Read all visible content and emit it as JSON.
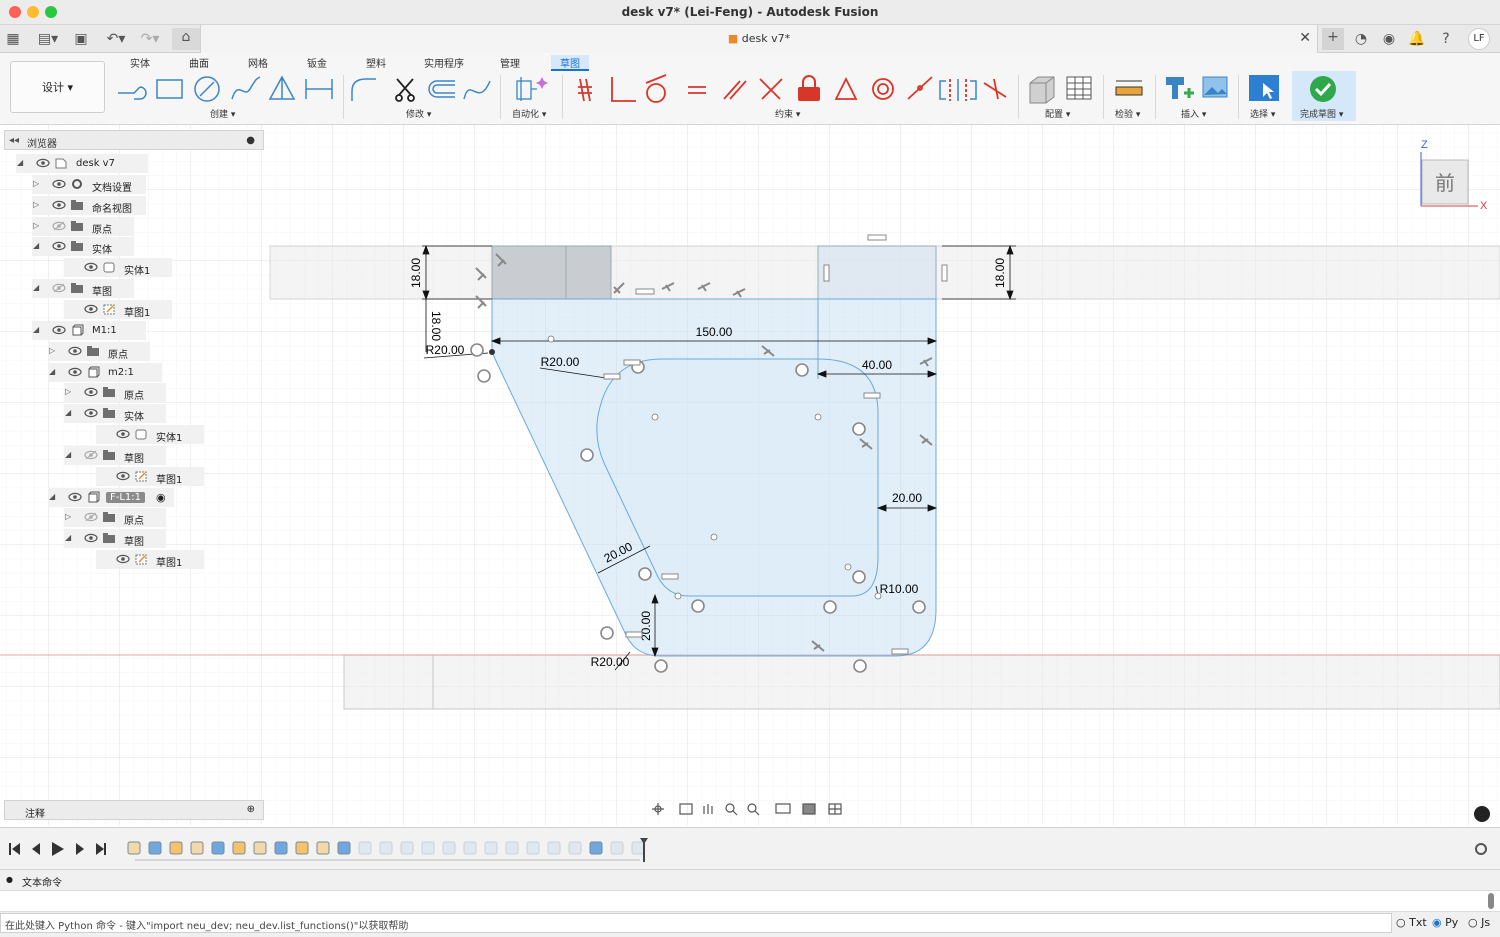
{
  "window": {
    "title": "desk v7* (Lei-Feng) - Autodesk Fusion"
  },
  "tabbar": {
    "doc_tab": "desk v7*",
    "avatar": "LF"
  },
  "ribbon": {
    "workspace": "设计 ▾",
    "tabs": [
      "实体",
      "曲面",
      "网格",
      "钣金",
      "塑料",
      "实用程序",
      "管理",
      "草图"
    ],
    "active_tab": "草图",
    "groups": {
      "create": "创建 ▾",
      "modify": "修改 ▾",
      "automate": "自动化 ▾",
      "constraints": "约束 ▾",
      "configure": "配置 ▾",
      "inspect": "检验 ▾",
      "insert": "插入 ▾",
      "select": "选择 ▾",
      "finish": "完成草图 ▾"
    }
  },
  "browser": {
    "title": "浏览器",
    "items": [
      {
        "label": "desk v7"
      },
      {
        "label": "文档设置"
      },
      {
        "label": "命名视图"
      },
      {
        "label": "原点"
      },
      {
        "label": "实体"
      },
      {
        "label": "实体1"
      },
      {
        "label": "草图"
      },
      {
        "label": "草图1"
      },
      {
        "label": "M1:1"
      },
      {
        "label": "原点"
      },
      {
        "label": "m2:1"
      },
      {
        "label": "原点"
      },
      {
        "label": "实体"
      },
      {
        "label": "实体1"
      },
      {
        "label": "草图"
      },
      {
        "label": "草图1"
      },
      {
        "label": "F-L1:1"
      },
      {
        "label": "原点"
      },
      {
        "label": "草图"
      },
      {
        "label": "草图1"
      }
    ]
  },
  "notes": {
    "title": "注释"
  },
  "viewcube": {
    "face": "前",
    "axis_z": "Z",
    "axis_x": "X"
  },
  "sketch": {
    "dims": {
      "d_150": "150.00",
      "d_40": "40.00",
      "d_20_right": "20.00",
      "d_20_diag": "20.00",
      "d_20_vert": "20.00",
      "d_18_left": "18.00",
      "d_18_left2": "18.00",
      "d_18_right": "18.00",
      "r_20_top": "R20.00",
      "r_20_inner": "R20.00",
      "r_20_bottom": "R20.00",
      "r_10": "R10.00"
    }
  },
  "textcmd": {
    "title": "文本命令",
    "prompt": "在此处键入 Python 命令 - 键入\"import neu_dev; neu_dev.list_functions()\"以获取帮助",
    "modes": [
      "Txt",
      "Py",
      "Js"
    ],
    "selected_mode": "Py"
  },
  "colors": {
    "accent": "#1673d1",
    "sketch_fill": "#dcebf7",
    "sketch_line": "#6aaad9",
    "finish_green": "#2ea84a"
  }
}
